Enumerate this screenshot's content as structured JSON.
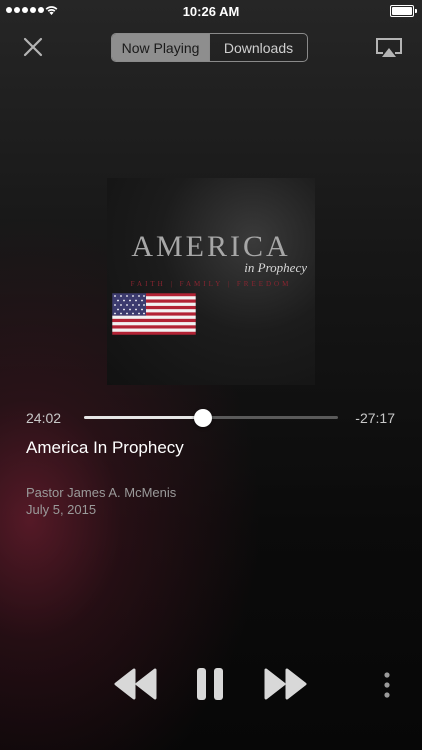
{
  "status_bar": {
    "time": "10:26 AM",
    "signal_icon": "signal-dots-icon",
    "wifi_icon": "wifi-icon",
    "battery_icon": "battery-icon"
  },
  "top_bar": {
    "close_icon": "close-icon",
    "tabs": [
      {
        "label": "Now Playing",
        "active": true
      },
      {
        "label": "Downloads",
        "active": false
      }
    ],
    "airplay_icon": "airplay-icon"
  },
  "artwork": {
    "title": "AMERICA",
    "subtitle": "in Prophecy",
    "tagline": "FAITH | FAMILY | FREEDOM",
    "flag_icon": "american-flag-icon"
  },
  "progress": {
    "elapsed": "24:02",
    "remaining": "-27:17",
    "fraction": 0.4696
  },
  "track": {
    "title": "America In Prophecy",
    "artist": "Pastor James A. McMenis",
    "date": "July 5, 2015"
  },
  "controls": {
    "rewind_icon": "rewind-icon",
    "pause_icon": "pause-icon",
    "forward_icon": "fast-forward-icon",
    "more_icon": "more-vertical-icon"
  },
  "colors": {
    "background": "#0b0b0b",
    "accent_glow": "#6e1e30",
    "segment_active": "#8e8e8e",
    "text_primary": "#ffffff",
    "text_secondary": "#9a9a9a"
  }
}
